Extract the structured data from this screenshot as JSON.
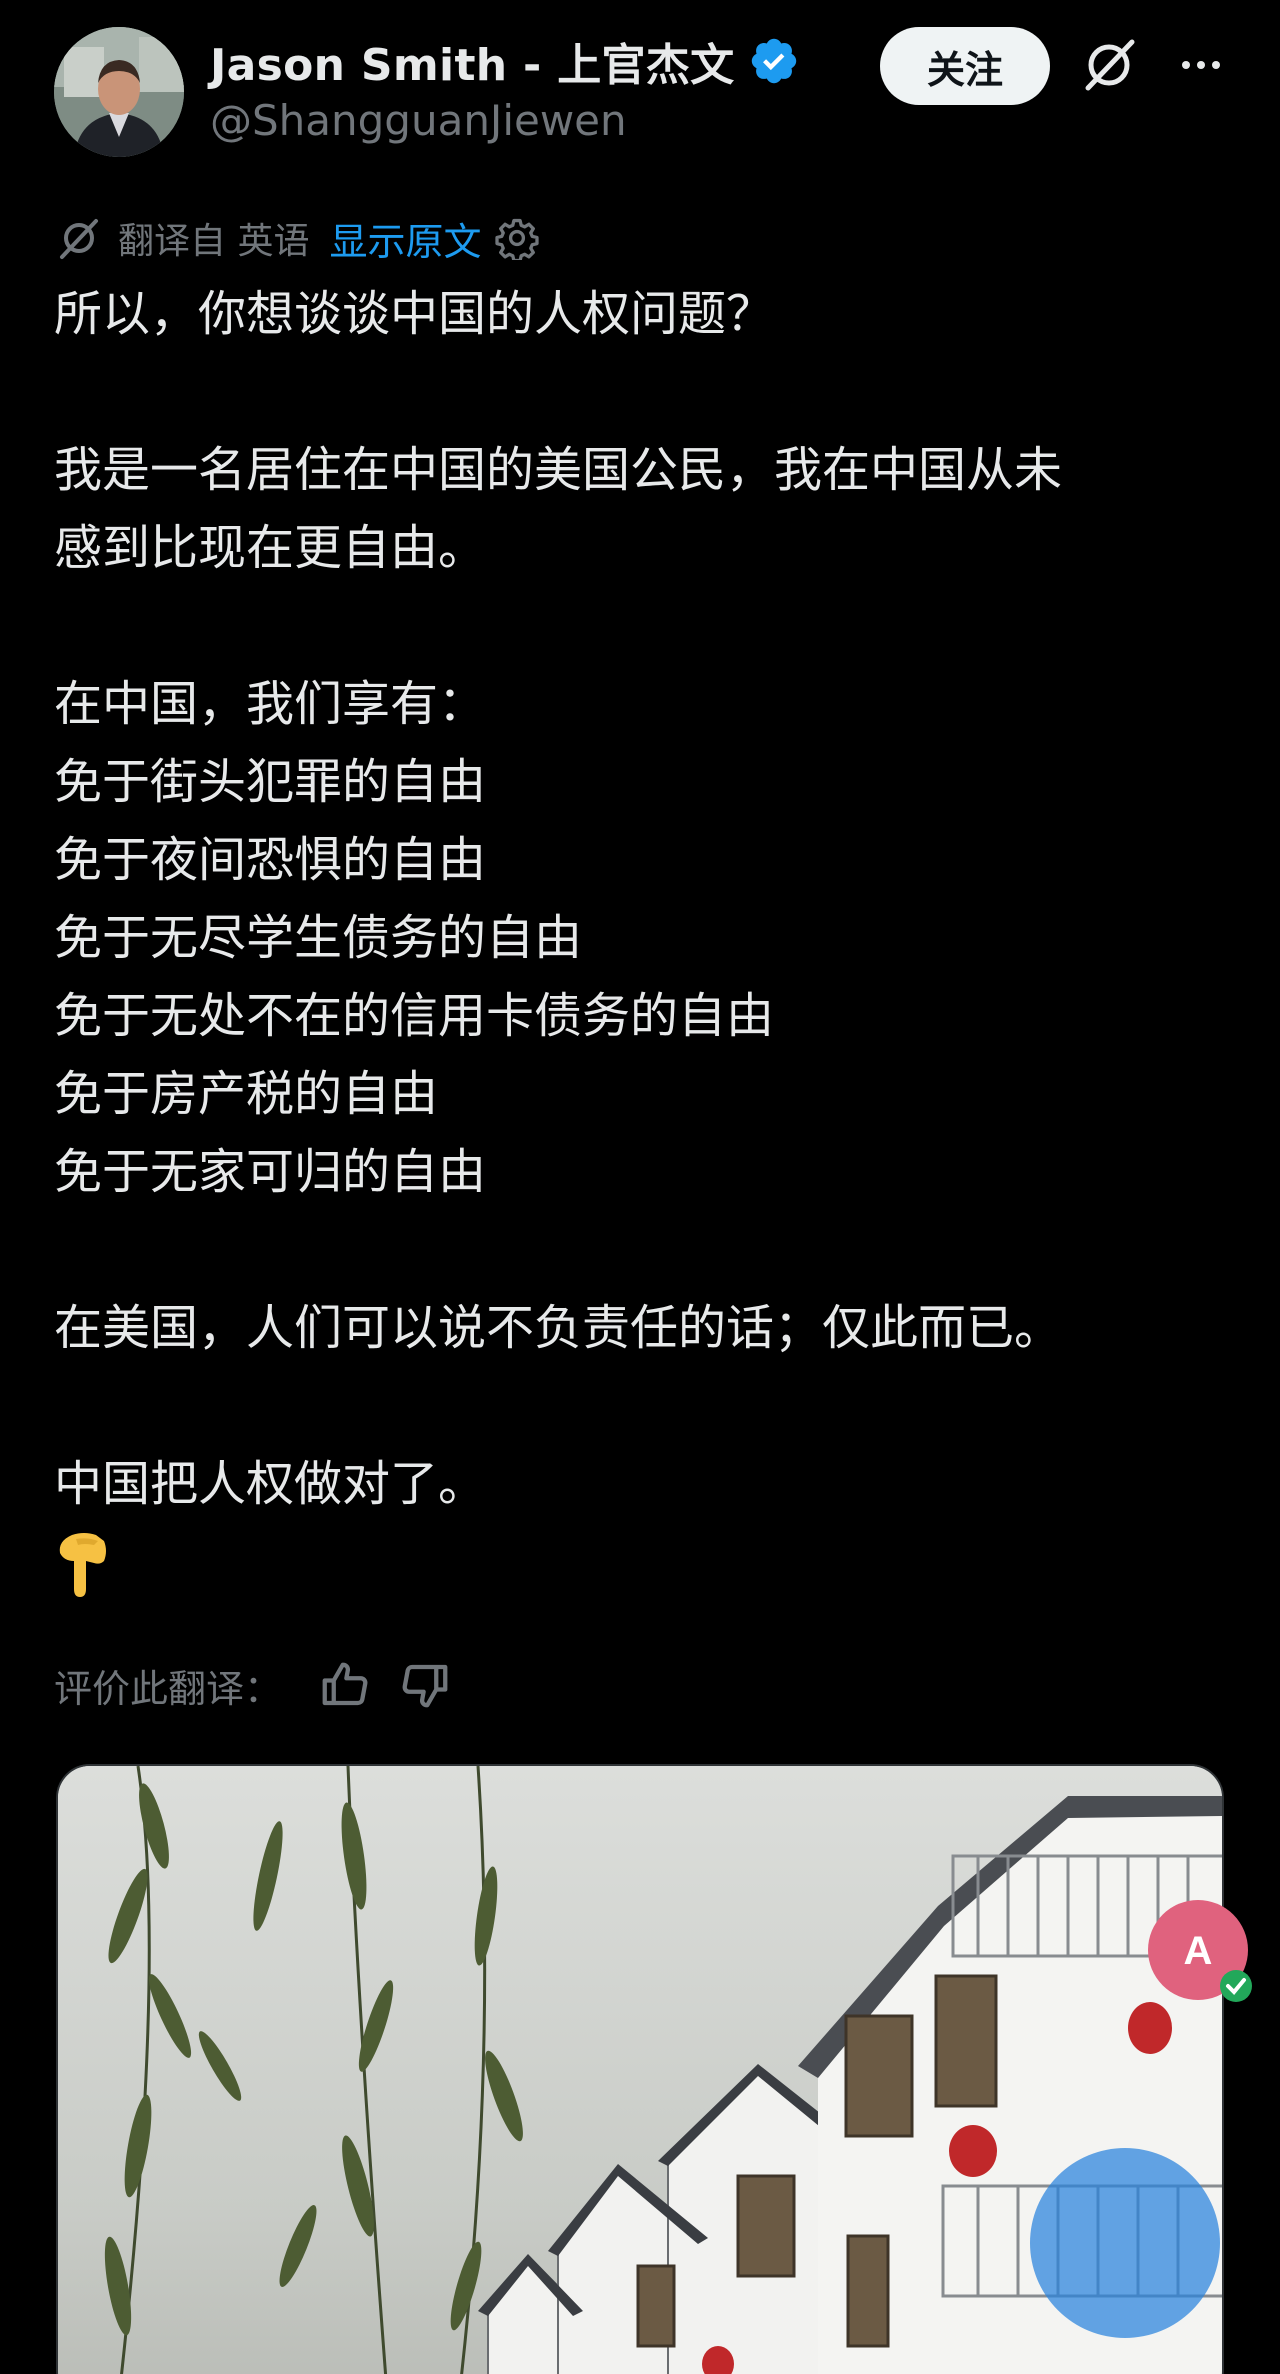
{
  "header": {
    "display_name": "Jason Smith - 上官杰文",
    "handle": "@ShangguanJiewen",
    "follow_label": "关注"
  },
  "translation": {
    "from_label": "翻译自 英语",
    "show_original_label": "显示原文"
  },
  "post": {
    "lines": [
      "所以，你想谈谈中国的人权问题？",
      "",
      "我是一名居住在中国的美国公民，我在中国从未",
      "感到比现在更自由。",
      "",
      "在中国，我们享有：",
      "免于街头犯罪的自由",
      "免于夜间恐惧的自由",
      "免于无尽学生债务的自由",
      "免于无处不在的信用卡债务的自由",
      "免于房产税的自由",
      "免于无家可归的自由",
      "",
      "在美国，人们可以说不负责任的话；仅此而已。",
      "",
      "中国把人权做对了。"
    ]
  },
  "rating": {
    "label": "评价此翻译："
  },
  "icons": {
    "verified": "verified-badge-icon",
    "grok": "grok-icon",
    "more": "more-icon",
    "translate": "translate-icon",
    "settings": "gear-icon",
    "thumb_up": "thumbs-up-icon",
    "thumb_down": "thumbs-down-icon",
    "pointing_down": "backhand-index-pointing-down-emoji"
  },
  "colors": {
    "background": "#000000",
    "text": "#e7e9ea",
    "muted": "#71767b",
    "link": "#1d9bf0",
    "verified": "#1d9bf0",
    "follow_bg": "#eff3f4"
  }
}
